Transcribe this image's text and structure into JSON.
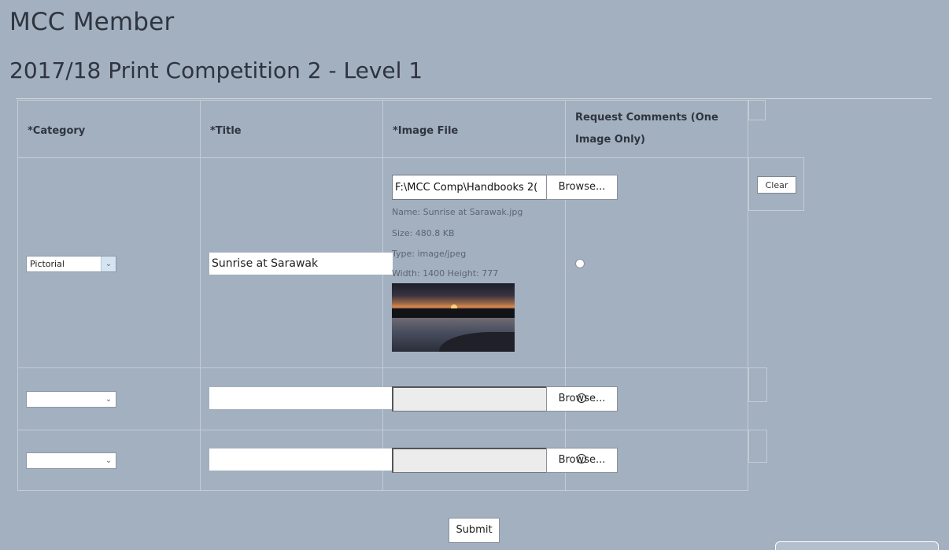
{
  "page": {
    "title": "MCC Member",
    "subtitle": "2017/18 Print Competition 2 - Level 1"
  },
  "table": {
    "headers": {
      "category": "*Category",
      "title": "*Title",
      "image_file": "*Image File",
      "request_comments_line1": "Request Comments (One",
      "request_comments_line2": "Image Only)"
    },
    "rows": [
      {
        "category": "Pictorial",
        "title": "Sunrise at Sarawak",
        "file_path": "F:\\MCC Comp\\Handbooks 2(",
        "browse_label": "Browse...",
        "name": "Name: Sunrise at Sarawak.jpg",
        "size": "Size: 480.8 KB",
        "type": "Type: image/jpeg",
        "dimensions": "Width: 1400 Height: 777",
        "clear_label": "Clear"
      },
      {
        "category": "",
        "title": "",
        "file_path": "",
        "browse_label": "Browse..."
      },
      {
        "category": "",
        "title": "",
        "file_path": "",
        "browse_label": "Browse..."
      }
    ]
  },
  "submit_label": "Submit"
}
